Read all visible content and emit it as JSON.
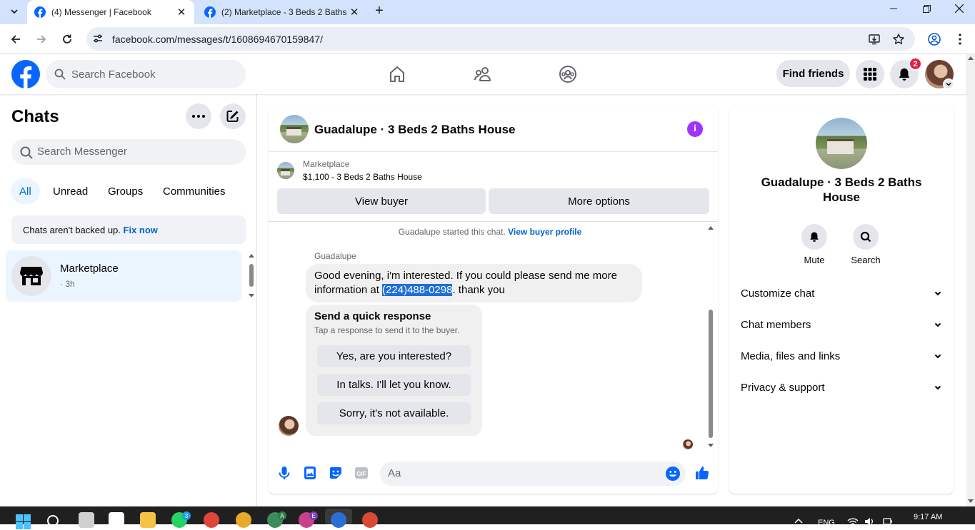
{
  "browser": {
    "tabs": [
      {
        "title": "(4) Messenger | Facebook",
        "active": true
      },
      {
        "title": "(2) Marketplace - 3 Beds 2 Baths",
        "active": false
      }
    ],
    "url": "facebook.com/messages/t/1608694670159847/"
  },
  "header": {
    "search_placeholder": "Search Facebook",
    "find_friends": "Find friends",
    "notification_count": "2"
  },
  "sidebar": {
    "title": "Chats",
    "search_placeholder": "Search Messenger",
    "filters": [
      "All",
      "Unread",
      "Groups",
      "Communities"
    ],
    "backup_text": "Chats aren't backed up.",
    "backup_link": "Fix now",
    "chats": [
      {
        "name": "Marketplace",
        "time": "· 3h"
      }
    ]
  },
  "conversation": {
    "title": "Guadalupe · 3 Beds 2 Baths House",
    "marketplace_label": "Marketplace",
    "listing": "$1,100 - 3 Beds 2 Baths House",
    "view_buyer": "View buyer",
    "more_options": "More options",
    "started_text": "Guadalupe started this chat.",
    "view_buyer_profile": "View buyer profile",
    "sender": "Guadalupe",
    "message_before": "Good evening, i'm interested. If you could please send me more information at ",
    "message_phone": "(224)488-0298",
    "message_after": ". thank you",
    "quick_title": "Send a quick response",
    "quick_sub": "Tap a response to send it to the buyer.",
    "quick_options": [
      "Yes, are you interested?",
      "In talks. I'll let you know.",
      "Sorry, it's not available."
    ],
    "composer_placeholder": "Aa"
  },
  "details": {
    "name": "Guadalupe · 3 Beds 2 Baths House",
    "actions": [
      "Mute",
      "Search"
    ],
    "sections": [
      "Customize chat",
      "Chat members",
      "Media, files and links",
      "Privacy & support"
    ]
  },
  "taskbar": {
    "lang": "ENG",
    "time": "9:17 AM",
    "badges": {
      "whatsapp": "3",
      "profile_e": "E",
      "profile_a": "A"
    }
  },
  "colors": {
    "fb_blue": "#0866ff",
    "link_blue": "#0064d1",
    "info_purple": "#a033ff",
    "badge_red": "#e41e3f"
  }
}
